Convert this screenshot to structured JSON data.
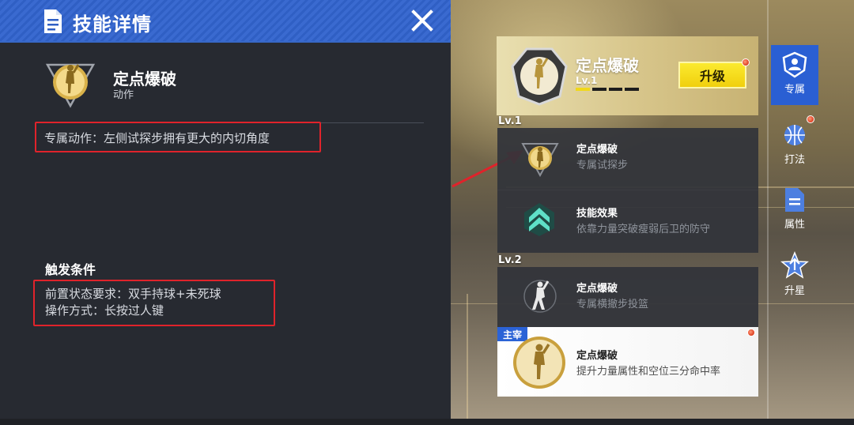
{
  "detail_panel": {
    "title": "技能详情",
    "skill_name": "定点爆破",
    "skill_type": "动作",
    "exclusive_action": "专属动作：左侧试探步拥有更大的内切角度",
    "trigger_title": "触发条件",
    "prerequisite": "前置状态要求：双手持球+未死球",
    "operation": "操作方式：长按过人键"
  },
  "skill_card": {
    "name": "定点爆破",
    "level": "Lv.1",
    "level_progress": 0.25,
    "upgrade_label": "升级"
  },
  "skill_list": {
    "level1_label": "Lv.1",
    "level2_label": "Lv.2",
    "rows": [
      {
        "title": "定点爆破",
        "desc": "专属试探步"
      },
      {
        "title": "技能效果",
        "desc": "依靠力量突破瘦弱后卫的防守"
      },
      {
        "title": "定点爆破",
        "desc": "专属横撤步投篮"
      }
    ],
    "master": {
      "tag": "主宰",
      "title": "定点爆破",
      "desc": "提升力量属性和空位三分命中率"
    }
  },
  "tabs": [
    {
      "label": "专属",
      "icon": "player-shield-icon",
      "active": true
    },
    {
      "label": "打法",
      "icon": "basketball-icon",
      "active": false
    },
    {
      "label": "属性",
      "icon": "document-icon",
      "active": false
    },
    {
      "label": "升星",
      "icon": "star-icon",
      "active": false
    }
  ],
  "colors": {
    "header_blue": "#3467cc",
    "highlight_red": "#e0232b",
    "upgrade_yellow": "#f4d81a",
    "active_tab": "#2a5fd3"
  }
}
